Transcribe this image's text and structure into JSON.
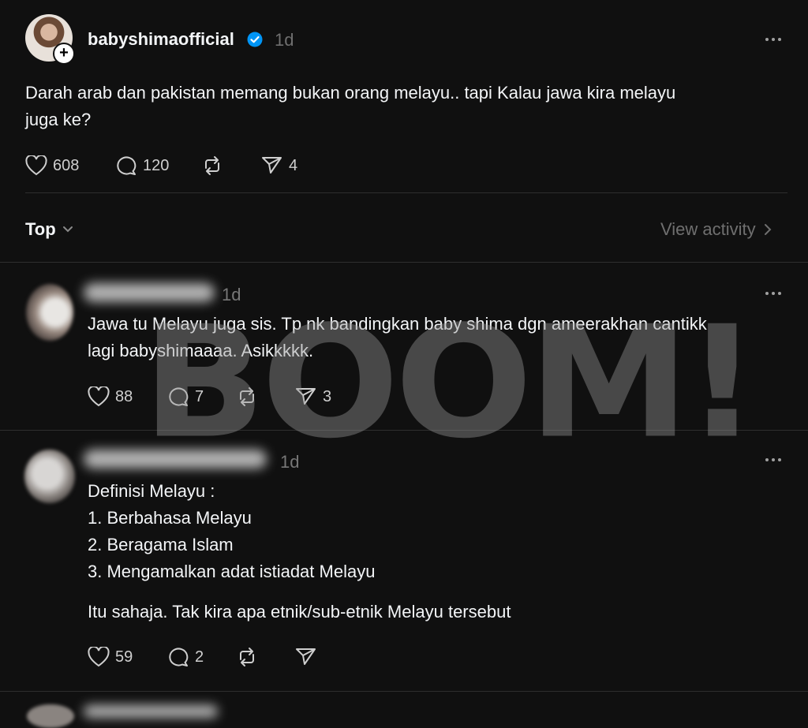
{
  "post": {
    "username": "babyshimaofficial",
    "time": "1d",
    "text_line1": "Darah arab dan pakistan memang bukan orang melayu.. tapi Kalau jawa kira melayu",
    "text_line2": "juga ke?",
    "likes": "608",
    "comments": "120",
    "shares": "4"
  },
  "sort": {
    "label": "Top",
    "view_activity": "View activity"
  },
  "replies": [
    {
      "time": "1d",
      "text_line1": "Jawa tu Melayu juga sis. Tp nk bandingkan baby shima dgn ameerakhan cantikk",
      "text_line2": "lagi babyshimaaaa. Asikkkkk.",
      "likes": "88",
      "comments": "7",
      "shares": "3"
    },
    {
      "time": "1d",
      "lines": [
        "Definisi Melayu :",
        "1. Berbahasa Melayu",
        "2. Beragama Islam",
        "3. Mengamalkan adat istiadat Melayu"
      ],
      "closing": "Itu sahaja. Tak kira apa etnik/sub-etnik Melayu tersebut",
      "likes": "59",
      "comments": "2"
    }
  ],
  "watermark": "BOOM!",
  "colors": {
    "background": "#101010",
    "verified": "#0095f6",
    "muted": "#777777"
  }
}
